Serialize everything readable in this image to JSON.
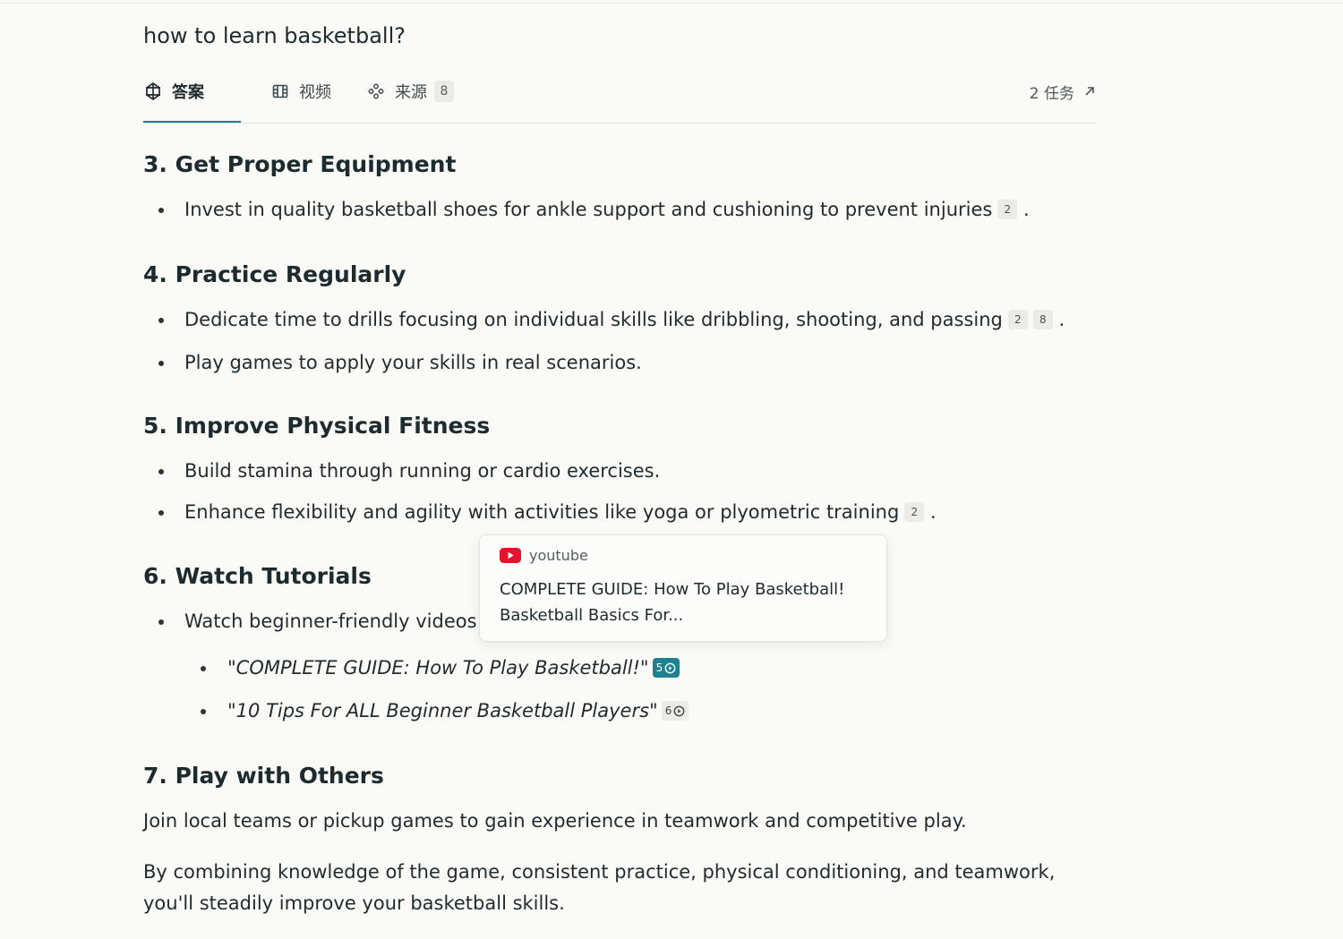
{
  "query": "how to learn basketball?",
  "tabs": {
    "answer": "答案",
    "video": "视频",
    "sources": "来源",
    "sources_count": "8",
    "tasks": "2 任务"
  },
  "sections": {
    "s3": {
      "title": "3. Get Proper Equipment",
      "b1": "Invest in quality basketball shoes for ankle support and cushioning to prevent injuries",
      "b1_cites": [
        "2"
      ]
    },
    "s4": {
      "title": "4. Practice Regularly",
      "b1": "Dedicate time to drills focusing on individual skills like dribbling, shooting, and passing",
      "b1_cites": [
        "2",
        "8"
      ],
      "b2": "Play games to apply your skills in real scenarios."
    },
    "s5": {
      "title": "5. Improve Physical Fitness",
      "b1": "Build stamina through running or cardio exercises.",
      "b2": "Enhance flexibility and agility with activities like yoga or plyometric training",
      "b2_cites": [
        "2"
      ]
    },
    "s6": {
      "title": "6. Watch Tutorials",
      "b1": "Watch beginner-friendly videos",
      "v1": "\"COMPLETE GUIDE: How To Play Basketball!\"",
      "v1_cite": "5",
      "v2": "\"10 Tips For ALL Beginner Basketball Players\"",
      "v2_cite": "6"
    },
    "s7": {
      "title": "7. Play with Others",
      "p1": "Join local teams or pickup games to gain experience in teamwork and competitive play.",
      "p2": "By combining knowledge of the game, consistent practice, physical conditioning, and teamwork, you'll steadily improve your basketball skills."
    }
  },
  "popup": {
    "source": "youtube",
    "title": "COMPLETE GUIDE: How To Play Basketball! Basketball Basics For..."
  },
  "colors": {
    "accent": "#20808d",
    "youtube_red": "#e8112d",
    "background": "#fafaf7"
  },
  "icons": {
    "answer": "perplexity-logo-icon",
    "video": "film-icon",
    "sources": "sources-dots-icon",
    "tasks": "arrow-up-right-icon",
    "popup_source": "youtube-icon",
    "video_cite": "play-circle-icon"
  }
}
